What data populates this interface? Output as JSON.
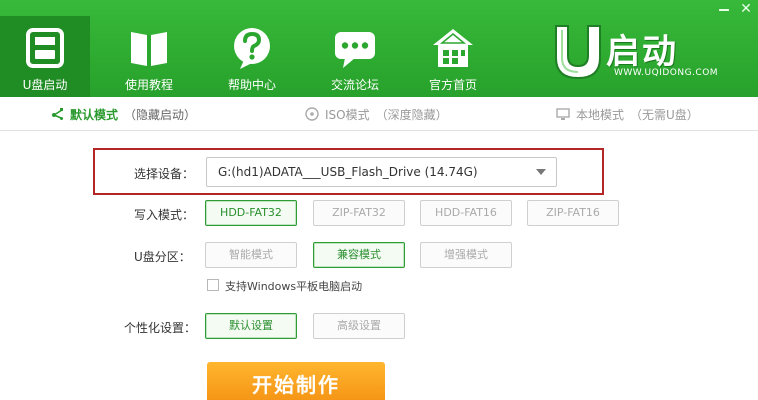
{
  "window": {
    "minimize_glyph": "—",
    "close_glyph": "✕"
  },
  "nav": {
    "items": [
      {
        "label": "U盘启动",
        "icon": "usb-drive-icon",
        "active": true
      },
      {
        "label": "使用教程",
        "icon": "book-icon",
        "active": false
      },
      {
        "label": "帮助中心",
        "icon": "question-icon",
        "active": false
      },
      {
        "label": "交流论坛",
        "icon": "chat-bubble-icon",
        "active": false
      },
      {
        "label": "官方首页",
        "icon": "home-icon",
        "active": false
      }
    ]
  },
  "logo": {
    "text": "启动",
    "url": "WWW.UQIDONG.COM"
  },
  "modes": [
    {
      "label": "默认模式",
      "hint": "（隐藏启动）",
      "icon": "usb-icon",
      "active": true
    },
    {
      "label": "ISO模式",
      "hint": "（深度隐藏）",
      "icon": "disc-icon",
      "active": false
    },
    {
      "label": "本地模式",
      "hint": "（无需U盘）",
      "icon": "monitor-icon",
      "active": false
    }
  ],
  "form": {
    "device": {
      "label": "选择设备：",
      "value": "G:(hd1)ADATA___USB_Flash_Drive (14.74G)"
    },
    "write_mode": {
      "label": "写入模式：",
      "options": [
        "HDD-FAT32",
        "ZIP-FAT32",
        "HDD-FAT16",
        "ZIP-FAT16"
      ],
      "selected": "HDD-FAT32"
    },
    "partition": {
      "label": "U盘分区：",
      "options": [
        "智能模式",
        "兼容模式",
        "增强模式"
      ],
      "selected": "兼容模式"
    },
    "windows_tablet": {
      "label": "支持Windows平板电脑启动",
      "checked": false
    },
    "personalize": {
      "label": "个性化设置：",
      "options": [
        "默认设置",
        "高级设置"
      ],
      "selected": "默认设置"
    },
    "start_button": "开始制作"
  },
  "colors": {
    "header_green": "#2fae33",
    "active_tab_green": "#1f8c24",
    "highlight_red": "#b42525",
    "start_orange": "#f5a21b",
    "selected_green": "#2f9c33"
  }
}
